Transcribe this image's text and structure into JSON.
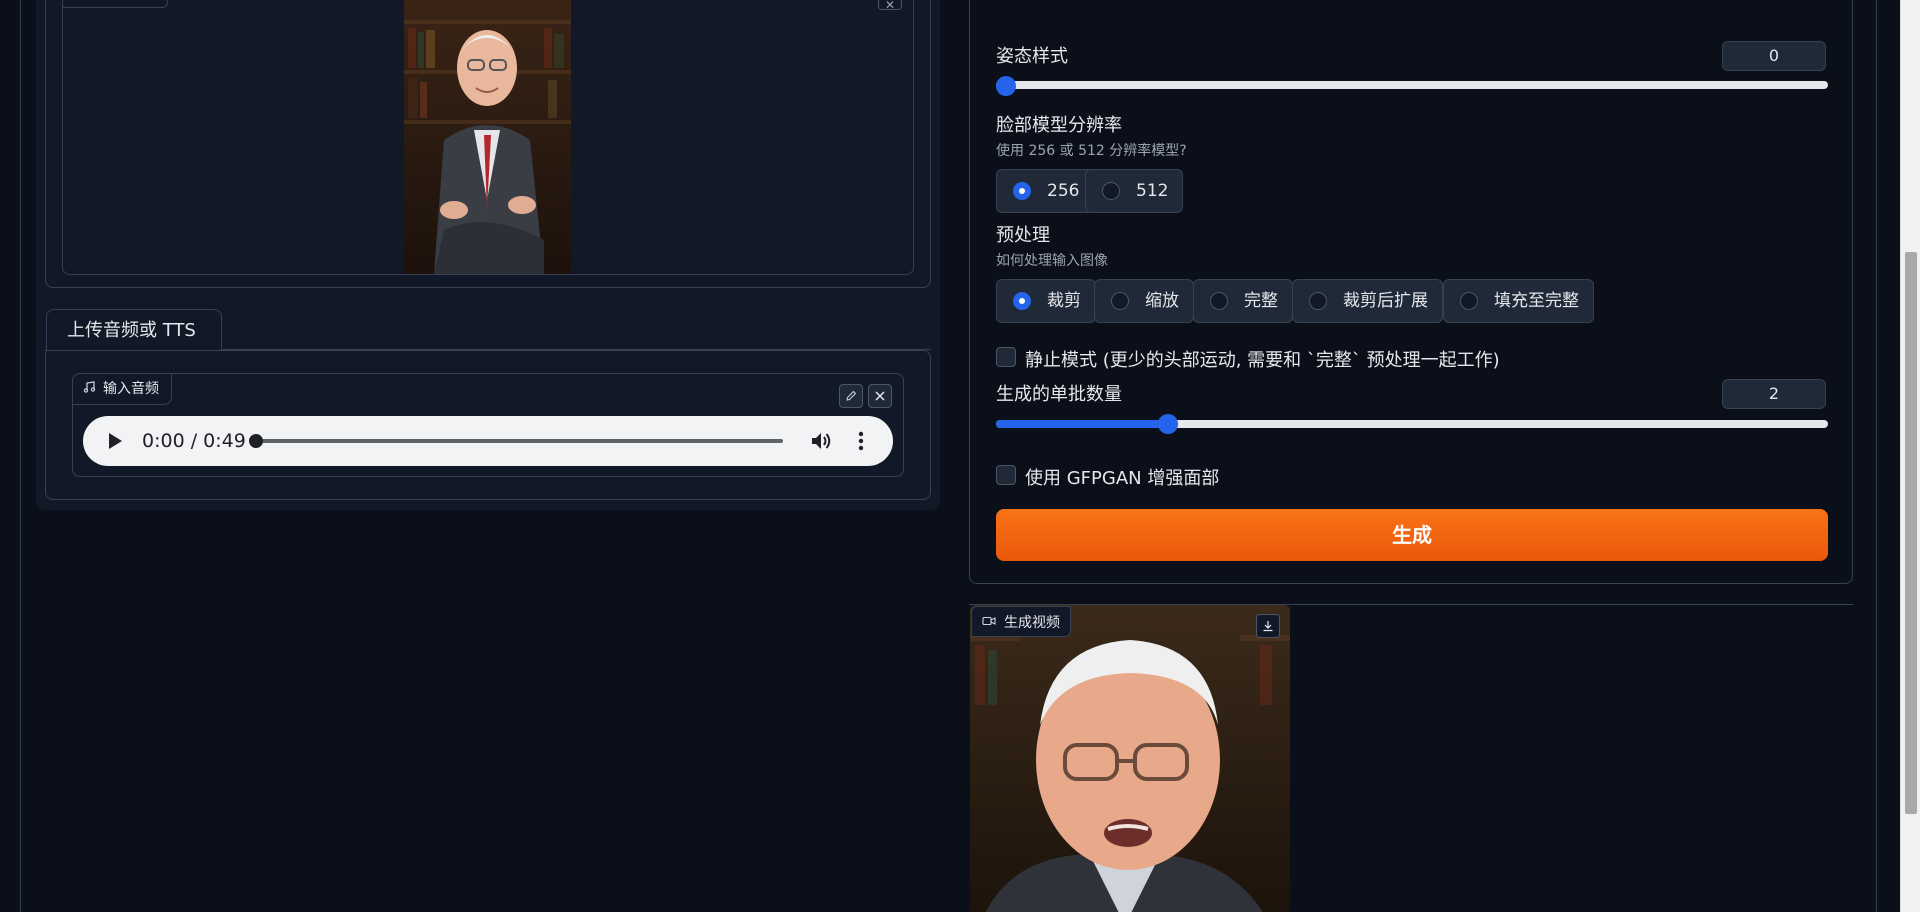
{
  "source_image": {
    "label": "",
    "image_alt": "portrait"
  },
  "audio_tab": {
    "tab_label": "上传音频或 TTS",
    "input_label": "输入音频",
    "time": "0:00 / 0:49"
  },
  "settings": {
    "pose_style": {
      "label": "姿态样式",
      "value": "0",
      "level": 0.0
    },
    "face_resolution": {
      "label": "脸部模型分辨率",
      "hint": "使用 256 或 512 分辨率模型?",
      "options": [
        "256",
        "512"
      ],
      "selected": "256"
    },
    "preprocess": {
      "label": "预处理",
      "hint": "如何处理输入图像",
      "options": [
        "裁剪",
        "缩放",
        "完整",
        "裁剪后扩展",
        "填充至完整"
      ],
      "selected": "裁剪"
    },
    "still_mode": {
      "label": "静止模式 (更少的头部运动, 需要和 `完整` 预处理一起工作)",
      "checked": false
    },
    "batch_size": {
      "label": "生成的单批数量",
      "value": "2",
      "level": 0.2
    },
    "gfpgan": {
      "label": "使用 GFPGAN 增强面部",
      "checked": false
    },
    "generate_label": "生成"
  },
  "output": {
    "label": "生成视频"
  },
  "colors": {
    "background": "#0b0f19",
    "panel": "#111827",
    "accent_blue": "#2563eb",
    "generate_orange": "#f97316"
  }
}
